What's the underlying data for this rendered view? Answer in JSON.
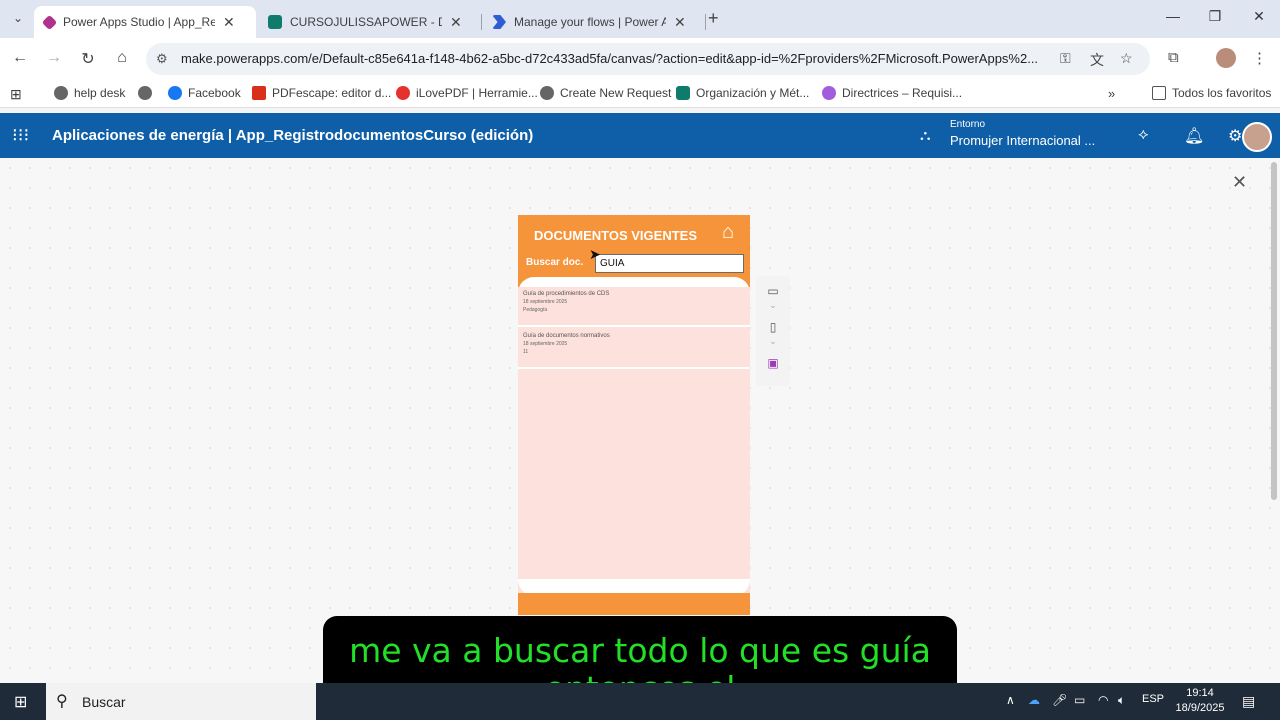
{
  "browser": {
    "tabs": [
      {
        "title": "Power Apps Studio | App_Reg",
        "active": true,
        "icon_color": "#b0328f"
      },
      {
        "title": "CURSOJULISSAPOWER - Docu",
        "active": false,
        "icon_color": "#0f7b6c"
      },
      {
        "title": "Manage your flows | Power Aut",
        "active": false,
        "icon_color": "#2f5bd3"
      }
    ],
    "url": "make.powerapps.com/e/Default-c85e641a-f148-4b62-a5bc-d72c433ad5fa/canvas/?action=edit&app-id=%2Fproviders%2FMicrosoft.PowerApps%2...",
    "bookmarks": [
      {
        "label": "help desk"
      },
      {
        "label": "Facebook"
      },
      {
        "label": "PDFescape: editor d..."
      },
      {
        "label": "iLovePDF | Herramie..."
      },
      {
        "label": "Create New Request"
      },
      {
        "label": "Organización y Mét..."
      },
      {
        "label": "Directrices – Requisi..."
      }
    ],
    "all_favorites": "Todos los favoritos"
  },
  "app_header": {
    "title": "Aplicaciones de energía | App_RegistrodocumentosCurso (edición)",
    "env_label": "Entorno",
    "env_name": "Promujer Internacional ..."
  },
  "phone_app": {
    "title": "DOCUMENTOS VIGENTES",
    "search_label": "Buscar doc.",
    "search_value": "GUIA",
    "documents": [
      {
        "name": "Guía de procedimientos de CDS",
        "date": "18 septiembre 2025",
        "extra": "Pedagogía"
      },
      {
        "name": "Guía de documentos normativos",
        "date": "18 septiembre 2025",
        "extra": "11"
      }
    ]
  },
  "subtitle": {
    "line1": "me va a buscar todo lo que es guía",
    "line2": "entonces el"
  },
  "taskbar": {
    "search": "Buscar",
    "lang": "ESP",
    "time": "19:14",
    "date": "18/9/2025"
  }
}
